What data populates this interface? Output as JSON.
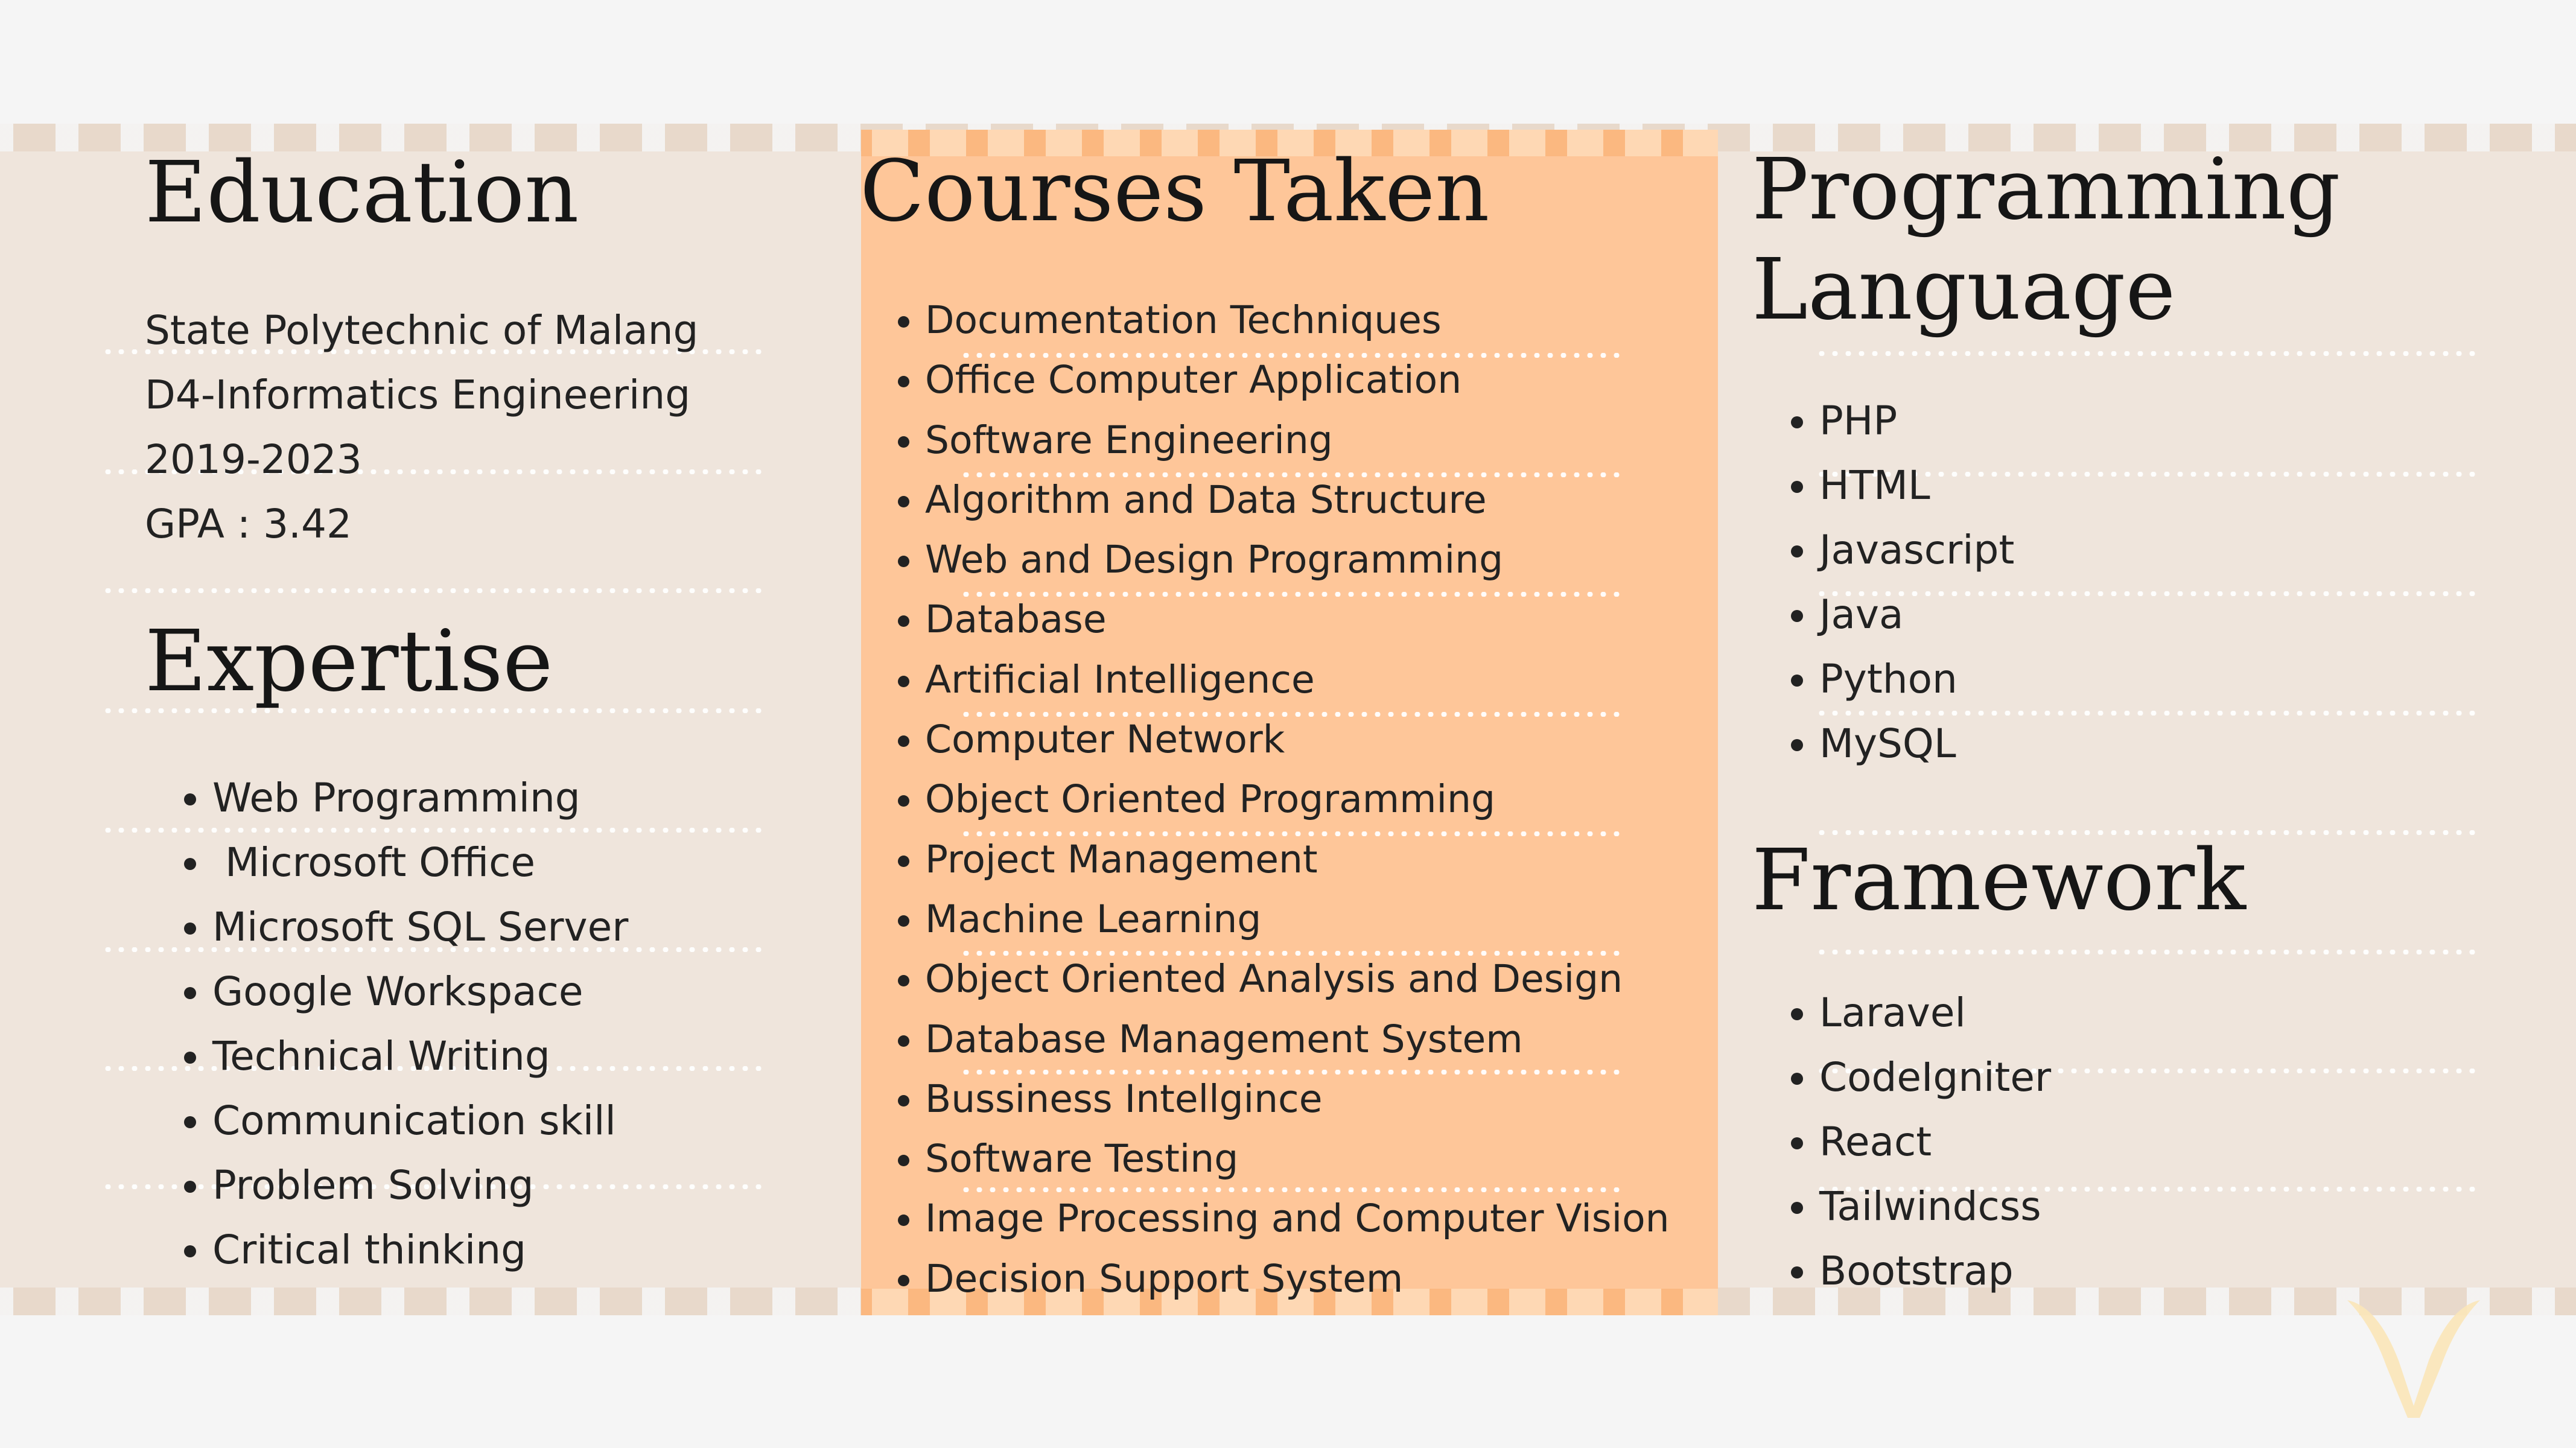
{
  "education": {
    "title": "Education",
    "lines": [
      "State Polytechnic of Malang",
      "D4-Informatics Engineering",
      "2019-2023",
      "GPA : 3.42"
    ]
  },
  "expertise": {
    "title": "Expertise",
    "items": [
      "Web Programming",
      " Microsoft Office",
      "Microsoft SQL Server",
      "Google Workspace",
      "Technical Writing",
      "Communication skill",
      "Problem Solving",
      "Critical thinking"
    ]
  },
  "courses": {
    "title": "Courses Taken",
    "items": [
      "Documentation Techniques",
      "Office Computer Application",
      "Software Engineering",
      "Algorithm and Data Structure",
      "Web and Design Programming",
      "Database",
      "Artificial Intelligence",
      "Computer Network",
      "Object Oriented Programming",
      "Project Management",
      "Machine Learning",
      "Object Oriented Analysis and Design",
      "Database Management System",
      "Bussiness Intellgince",
      "Software Testing",
      "Image Processing and Computer Vision",
      "Decision Support System"
    ]
  },
  "programming": {
    "title_line1": "Programming",
    "title_line2": "Language",
    "items": [
      "PHP",
      "HTML",
      "Javascript",
      "Java",
      "Python",
      "MySQL"
    ]
  },
  "framework": {
    "title": "Framework",
    "items": [
      "Laravel",
      "CodeIgniter",
      "React",
      "Tailwindcss",
      "Bootstrap"
    ]
  },
  "colors": {
    "background": "#f5f5f5",
    "band": "#efe5dc",
    "highlight_column": "#fec699",
    "logo": "#fbe6b8"
  },
  "icons": {
    "corner_logo": "chevron-logo-icon"
  }
}
